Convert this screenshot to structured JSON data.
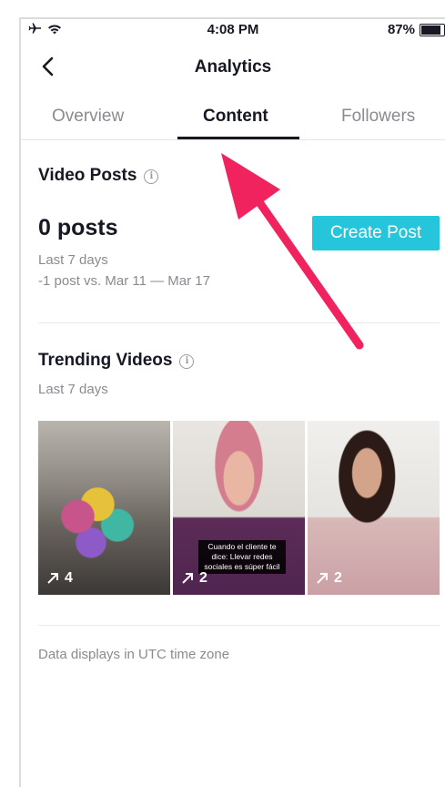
{
  "status_bar": {
    "time": "4:08 PM",
    "battery": "87%",
    "icons": [
      "airplane-icon",
      "wifi-icon",
      "battery-icon"
    ]
  },
  "header": {
    "title": "Analytics",
    "back_icon": "chevron-left-icon"
  },
  "tabs": [
    {
      "label": "Overview",
      "active": false
    },
    {
      "label": "Content",
      "active": true
    },
    {
      "label": "Followers",
      "active": false
    }
  ],
  "video_posts": {
    "title": "Video Posts",
    "count": "0 posts",
    "period": "Last 7 days",
    "comparison": "-1 post vs. Mar 11 — Mar 17",
    "create_button": "Create Post"
  },
  "trending": {
    "title": "Trending Videos",
    "period": "Last 7 days",
    "videos": [
      {
        "stat": "4",
        "caption": ""
      },
      {
        "stat": "2",
        "caption": "Cuando el cliente te dice: Llevar redes sociales es súper fácil"
      },
      {
        "stat": "2",
        "caption": ""
      }
    ]
  },
  "footer": {
    "note": "Data displays in UTC time zone"
  },
  "colors": {
    "accent": "#25c5dc",
    "annotation_arrow": "#f0235f",
    "text_primary": "#161823",
    "text_secondary": "#8a8b91"
  }
}
